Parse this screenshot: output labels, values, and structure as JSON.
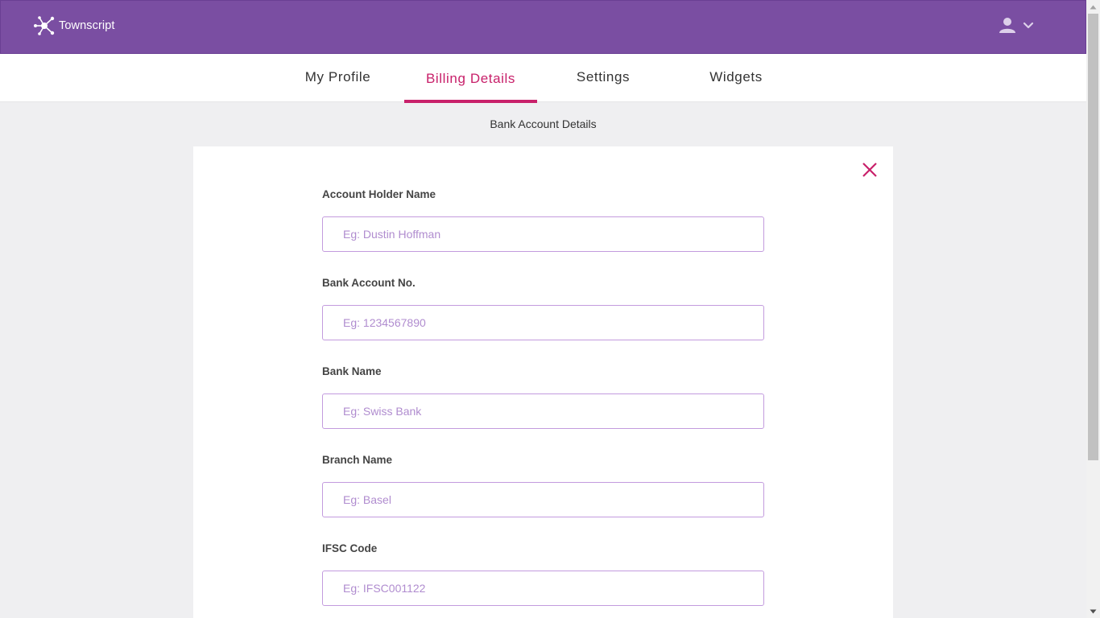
{
  "header": {
    "brand": "Townscript",
    "logo_icon": "network-nodes-icon",
    "user_icon": "user-icon",
    "dropdown_icon": "chevron-down-icon"
  },
  "tabs": [
    {
      "label": "My Profile",
      "active": false
    },
    {
      "label": "Billing Details",
      "active": true
    },
    {
      "label": "Settings",
      "active": false
    },
    {
      "label": "Widgets",
      "active": false
    }
  ],
  "section": {
    "title": "Bank Account Details",
    "close_icon": "close-icon"
  },
  "form": {
    "fields": [
      {
        "label": "Account Holder Name",
        "value": "",
        "placeholder": "Eg: Dustin Hoffman"
      },
      {
        "label": "Bank Account No.",
        "value": "",
        "placeholder": "Eg: 1234567890"
      },
      {
        "label": "Bank Name",
        "value": "",
        "placeholder": "Eg: Swiss Bank"
      },
      {
        "label": "Branch Name",
        "value": "",
        "placeholder": "Eg: Basel"
      },
      {
        "label": "IFSC Code",
        "value": "",
        "placeholder": "Eg: IFSC001122"
      }
    ]
  },
  "colors": {
    "header_bg": "#7a4ea2",
    "accent": "#c8206a",
    "input_border": "#c39bde",
    "placeholder": "#b08ccf",
    "page_bg": "#efeff1"
  }
}
